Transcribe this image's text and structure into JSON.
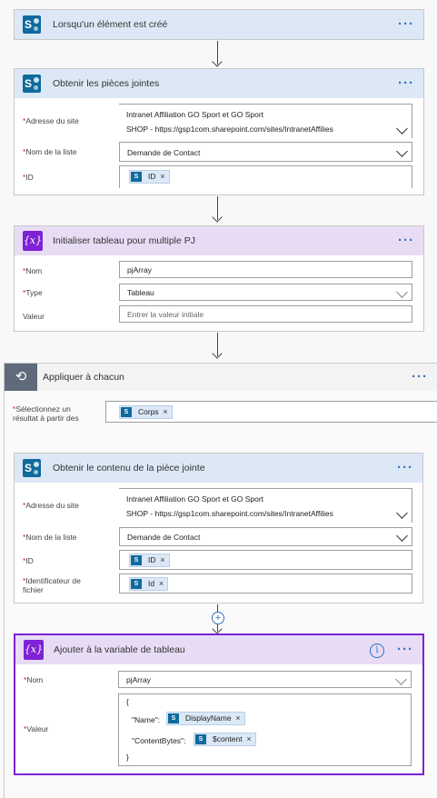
{
  "trigger": {
    "title": "Lorsqu'un élément est créé"
  },
  "get_attachments": {
    "title": "Obtenir les pièces jointes",
    "site_label": "Adresse du site",
    "site_value_line1": "Intranet Affiliation GO Sport et GO Sport",
    "site_value_line2": "SHOP - https://gsp1com.sharepoint.com/sites/IntranetAffilies",
    "list_label": "Nom de la liste",
    "list_value": "Demande de Contact",
    "id_label": "ID",
    "id_token": "ID"
  },
  "init_var": {
    "title": "Initialiser tableau pour multiple PJ",
    "name_label": "Nom",
    "name_value": "pjArray",
    "type_label": "Type",
    "type_value": "Tableau",
    "value_label": "Valeur",
    "value_placeholder": "Entrer la valeur initiale"
  },
  "apply_each": {
    "title": "Appliquer à chacun",
    "select_label_line1": "Sélectionnez un",
    "select_label_line2": "résultat à partir des",
    "select_token": "Corps"
  },
  "get_content": {
    "title": "Obtenir le contenu de la pièce jointe",
    "site_label": "Adresse du site",
    "site_value_line1": "Intranet Affiliation GO Sport et GO Sport",
    "site_value_line2": "SHOP - https://gsp1com.sharepoint.com/sites/IntranetAffilies",
    "list_label": "Nom de la liste",
    "list_value": "Demande de Contact",
    "id_label": "ID",
    "id_token": "ID",
    "file_label_line1": "Identificateur de",
    "file_label_line2": "fichier",
    "file_token": "Id"
  },
  "append_var": {
    "title": "Ajouter à la variable de tableau",
    "name_label": "Nom",
    "name_value": "pjArray",
    "value_label": "Valeur",
    "open_brace": "{",
    "name_key": "\"Name\":",
    "name_token": "DisplayName",
    "content_key": "\"ContentBytes\":",
    "content_token": "$content",
    "close_brace": "}"
  },
  "icons": {
    "sharepoint": "sharepoint-icon",
    "variable": "variable-icon",
    "loop": "loop-icon",
    "more": "more-icon",
    "info": "info-icon",
    "add": "add-step-icon",
    "dropdown": "chevron-down-icon",
    "remove": "close-icon"
  },
  "colors": {
    "sharepoint_header": "#dce8f5",
    "variable_header": "#e8dcf5",
    "variable_accent": "#7d22d4",
    "link_blue": "#2f6fbf",
    "required": "#c4262e"
  }
}
